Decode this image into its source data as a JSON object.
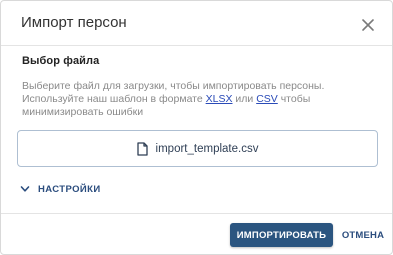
{
  "dialog": {
    "title": "Импорт персон",
    "close_icon": "close-icon"
  },
  "file_section": {
    "title": "Выбор файла",
    "description_line1": "Выберите файл для загрузки, чтобы импортировать персоны.",
    "description_line2_before": "Используйте наш шаблон в формате ",
    "link_xlsx": "XLSX",
    "description_or": " или ",
    "link_csv": "CSV",
    "description_line2_after": " чтобы",
    "description_line3": "минимизировать ошибки"
  },
  "file_picker": {
    "icon": "file-icon",
    "filename": "import_template.csv"
  },
  "settings": {
    "icon": "chevron-down-icon",
    "label": "НАСТРОЙКИ"
  },
  "footer": {
    "import_label": "ИМПОРТИРОВАТЬ",
    "cancel_label": "ОТМЕНА"
  },
  "colors": {
    "primary": "#2b5580",
    "link": "#2a4bb8",
    "muted_text": "#8a8a8a",
    "border": "#aebfd2"
  }
}
